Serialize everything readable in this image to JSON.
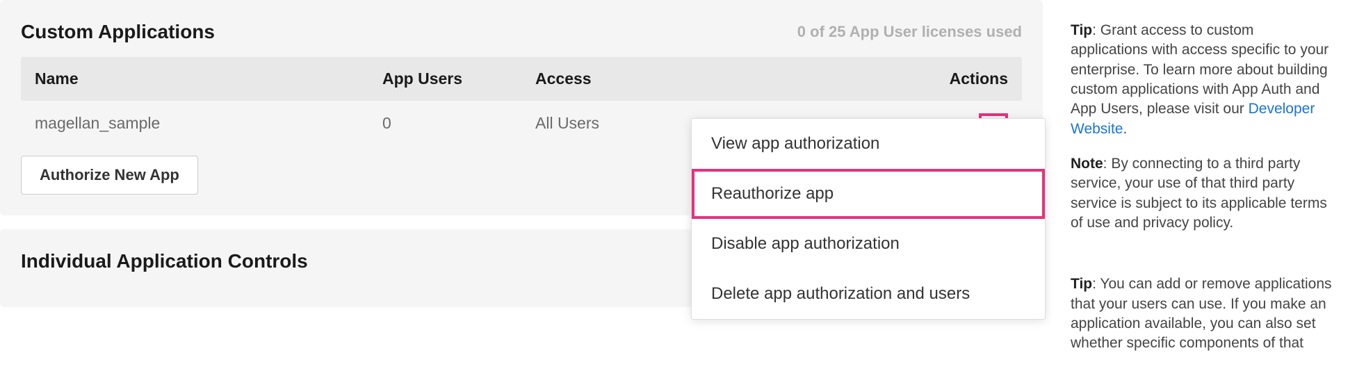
{
  "custom_apps": {
    "title": "Custom Applications",
    "license_info": "0 of 25 App User licenses used",
    "columns": {
      "name": "Name",
      "users": "App Users",
      "access": "Access",
      "actions": "Actions"
    },
    "rows": [
      {
        "name": "magellan_sample",
        "users": "0",
        "access": "All Users"
      }
    ],
    "authorize_button": "Authorize New App",
    "dropdown": {
      "view": "View app authorization",
      "reauthorize": "Reauthorize app",
      "disable": "Disable app authorization",
      "delete": "Delete app authorization and users"
    }
  },
  "individual_controls": {
    "title": "Individual Application Controls"
  },
  "sidebar": {
    "tip1": {
      "label": "Tip",
      "text_before": ": Grant access to custom applications with access specific to your enterprise. To learn more about building custom applications with App Auth and App Users, please visit our ",
      "link_text": "Developer Website",
      "text_after": "."
    },
    "note": {
      "label": "Note",
      "text": ": By connecting to a third party service, your use of that third party service is subject to its applicable terms of use and privacy policy."
    },
    "tip2": {
      "label": "Tip",
      "text": ": You can add or remove applications that your users can use. If you make an application available, you can also set whether specific components of that"
    }
  }
}
